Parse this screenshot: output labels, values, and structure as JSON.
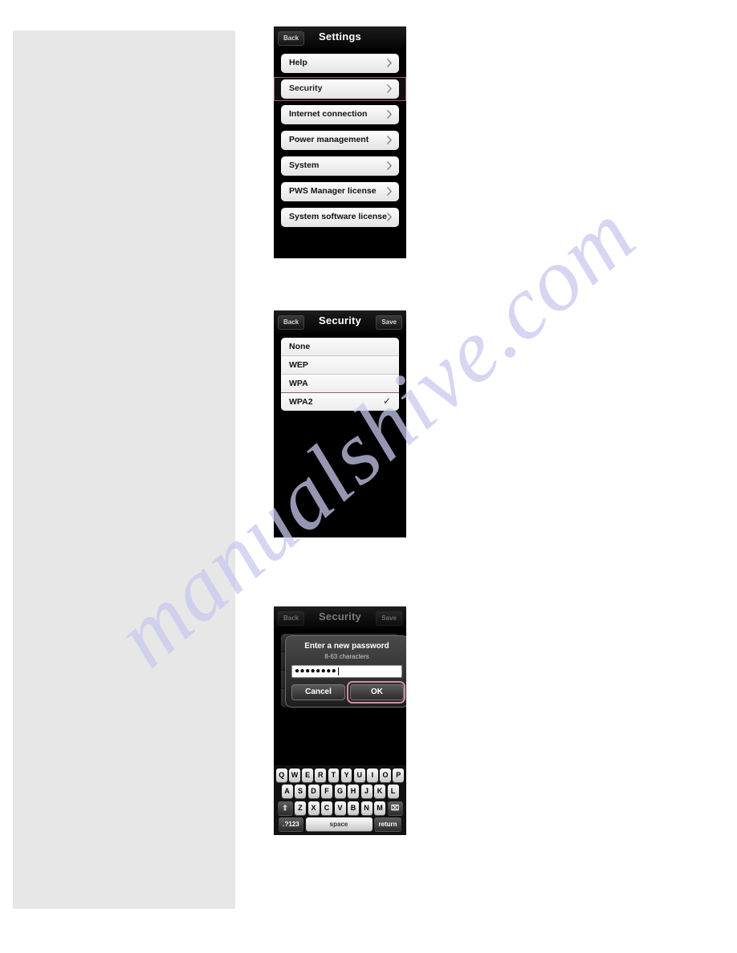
{
  "watermark": {
    "text": "manualshive.com"
  },
  "colors": {
    "highlight_border": "#9c5c72",
    "button_highlight": "#d08ca4",
    "panel_background": "#000000",
    "text_block_gray": "#e7e7e7"
  },
  "panel_settings": {
    "navbar": {
      "back_label": "Back",
      "title": "Settings"
    },
    "items": [
      {
        "label": "Help",
        "highlighted": false
      },
      {
        "label": "Security",
        "highlighted": true
      },
      {
        "label": "Internet connection",
        "highlighted": false
      },
      {
        "label": "Power management",
        "highlighted": false
      },
      {
        "label": "System",
        "highlighted": false
      },
      {
        "label": "PWS Manager license",
        "highlighted": false
      },
      {
        "label": "System software license",
        "highlighted": false
      }
    ]
  },
  "panel_security": {
    "navbar": {
      "back_label": "Back",
      "title": "Security",
      "save_label": "Save"
    },
    "options": [
      {
        "label": "None",
        "selected": false,
        "highlighted": false
      },
      {
        "label": "WEP",
        "selected": false,
        "highlighted": false
      },
      {
        "label": "WPA",
        "selected": false,
        "highlighted": false
      },
      {
        "label": "WPA2",
        "selected": true,
        "highlighted": true
      }
    ],
    "checkmark": "✓"
  },
  "panel_password": {
    "navbar": {
      "back_label": "Back",
      "title": "Security",
      "save_label": "Save"
    },
    "background_options": [
      {
        "label": "None"
      },
      {
        "label": "WEP"
      },
      {
        "label": "WPA"
      },
      {
        "label": "WPA2"
      }
    ],
    "dialog": {
      "title": "Enter a new password",
      "subtitle": "8-63 characters",
      "password_value": "●●●●●●●●",
      "cancel_label": "Cancel",
      "ok_label": "OK",
      "ok_highlighted": true
    },
    "keyboard": {
      "row1": [
        "Q",
        "W",
        "E",
        "R",
        "T",
        "Y",
        "U",
        "I",
        "O",
        "P"
      ],
      "row2": [
        "A",
        "S",
        "D",
        "F",
        "G",
        "H",
        "J",
        "K",
        "L"
      ],
      "row3": [
        "Z",
        "X",
        "C",
        "V",
        "B",
        "N",
        "M"
      ],
      "shift_label": "⇧",
      "backspace_label": "⌧",
      "numbers_label": ".?123",
      "space_label": "space",
      "return_label": "return"
    }
  }
}
